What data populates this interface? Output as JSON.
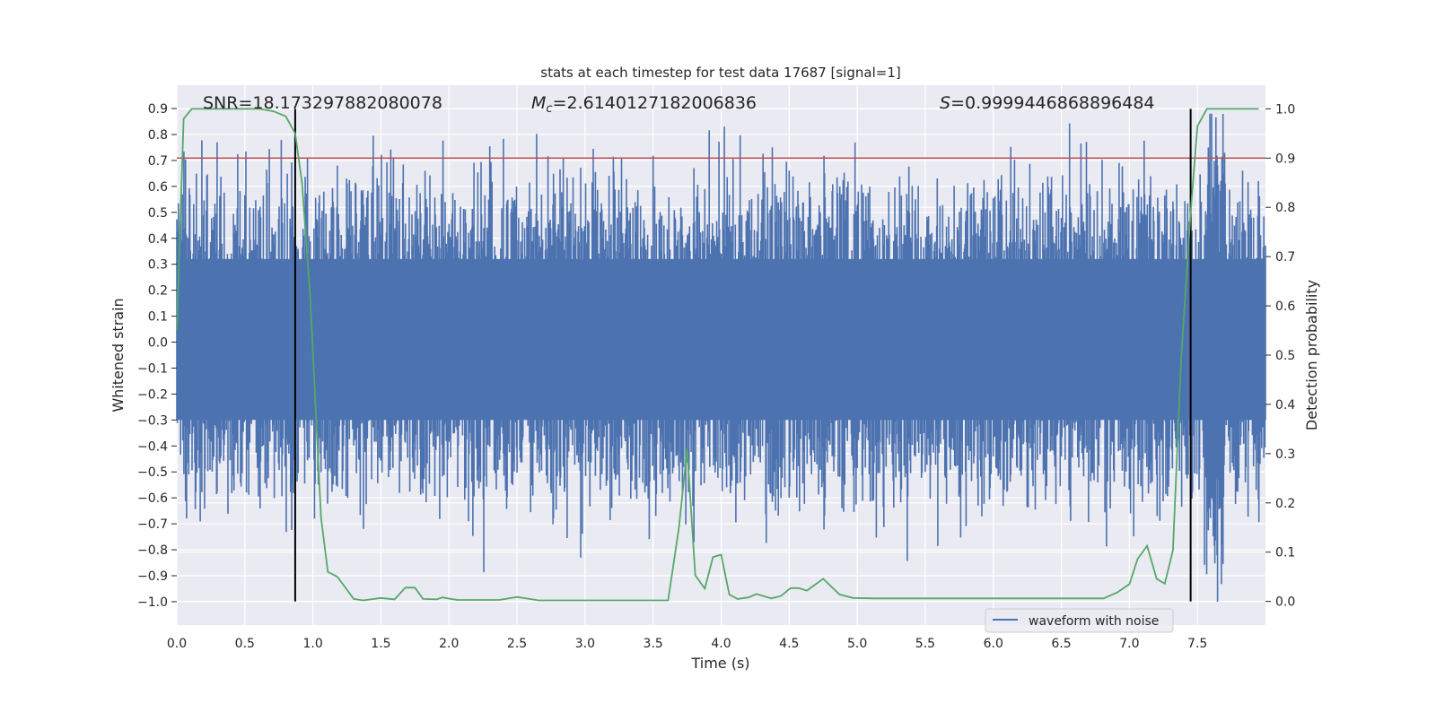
{
  "chart_data": {
    "type": "line",
    "title": "stats at each timestep for test data 17687 [signal=1]",
    "xlabel": "Time (s)",
    "ylabel": "Whitened strain",
    "ylabel_right": "Detection probability",
    "xlim": [
      0.0,
      8.0
    ],
    "ylim": [
      -1.09,
      0.99
    ],
    "ylim_right": [
      -0.048,
      1.048
    ],
    "x_ticks": [
      "0.0",
      "0.5",
      "1.0",
      "1.5",
      "2.0",
      "2.5",
      "3.0",
      "3.5",
      "4.0",
      "4.5",
      "5.0",
      "5.5",
      "6.0",
      "6.5",
      "7.0",
      "7.5"
    ],
    "y_ticks": [
      "0.9",
      "0.8",
      "0.7",
      "0.6",
      "0.5",
      "0.4",
      "0.3",
      "0.2",
      "0.1",
      "0.0",
      "−0.1",
      "−0.2",
      "−0.3",
      "−0.4",
      "−0.5",
      "−0.6",
      "−0.7",
      "−0.8",
      "−0.9",
      "−1.0"
    ],
    "y_ticks_right": [
      "1.0",
      "0.9",
      "0.8",
      "0.7",
      "0.6",
      "0.5",
      "0.4",
      "0.3",
      "0.2",
      "0.1",
      "0.0"
    ],
    "grid": true,
    "legend": {
      "placement": "lower-right",
      "entries": [
        "waveform with noise"
      ]
    },
    "annotations": {
      "snr": "SNR=18.173297882080078",
      "mc_symbol": "M",
      "mc_sub": "c",
      "mc_value": "=2.6140127182006836",
      "s_symbol": "S",
      "s_value": "=0.9999446868896484"
    },
    "threshold_right": 0.9,
    "vertical_lines_time": [
      0.87,
      7.45
    ],
    "colors": {
      "waveform": "#4c72b0",
      "probability": "#55a868",
      "threshold": "#c44e52",
      "markers": "#000000",
      "background": "#eaeaf2"
    },
    "series": [
      {
        "name": "waveform with noise",
        "axis": "left",
        "description_of_values": "noise"
      },
      {
        "axis": "right",
        "x": [
          0.0,
          0.05,
          0.11,
          0.61,
          0.71,
          0.8,
          0.87,
          0.92,
          0.98,
          1.06,
          1.11,
          1.18,
          1.25,
          1.3,
          1.37,
          1.5,
          1.6,
          1.68,
          1.75,
          1.81,
          1.91,
          1.95,
          2.06,
          2.37,
          2.5,
          2.66,
          3.61,
          3.69,
          3.75,
          3.81,
          3.88,
          3.94,
          4.0,
          4.06,
          4.12,
          4.2,
          4.26,
          4.37,
          4.44,
          4.51,
          4.57,
          4.63,
          4.75,
          4.87,
          4.97,
          5.13,
          6.81,
          6.91,
          7.0,
          7.06,
          7.13,
          7.2,
          7.26,
          7.32,
          7.38,
          7.45,
          7.5,
          7.57,
          7.95
        ],
        "y": [
          0.55,
          0.98,
          1.0,
          1.0,
          0.995,
          0.985,
          0.95,
          0.85,
          0.62,
          0.17,
          0.06,
          0.05,
          0.024,
          0.005,
          0.002,
          0.007,
          0.004,
          0.028,
          0.028,
          0.005,
          0.004,
          0.008,
          0.003,
          0.003,
          0.009,
          0.002,
          0.002,
          0.15,
          0.31,
          0.053,
          0.026,
          0.09,
          0.095,
          0.014,
          0.005,
          0.008,
          0.015,
          0.006,
          0.011,
          0.027,
          0.027,
          0.022,
          0.046,
          0.014,
          0.007,
          0.006,
          0.006,
          0.018,
          0.035,
          0.086,
          0.113,
          0.046,
          0.036,
          0.104,
          0.49,
          0.79,
          0.965,
          1.0,
          1.0
        ]
      }
    ]
  }
}
